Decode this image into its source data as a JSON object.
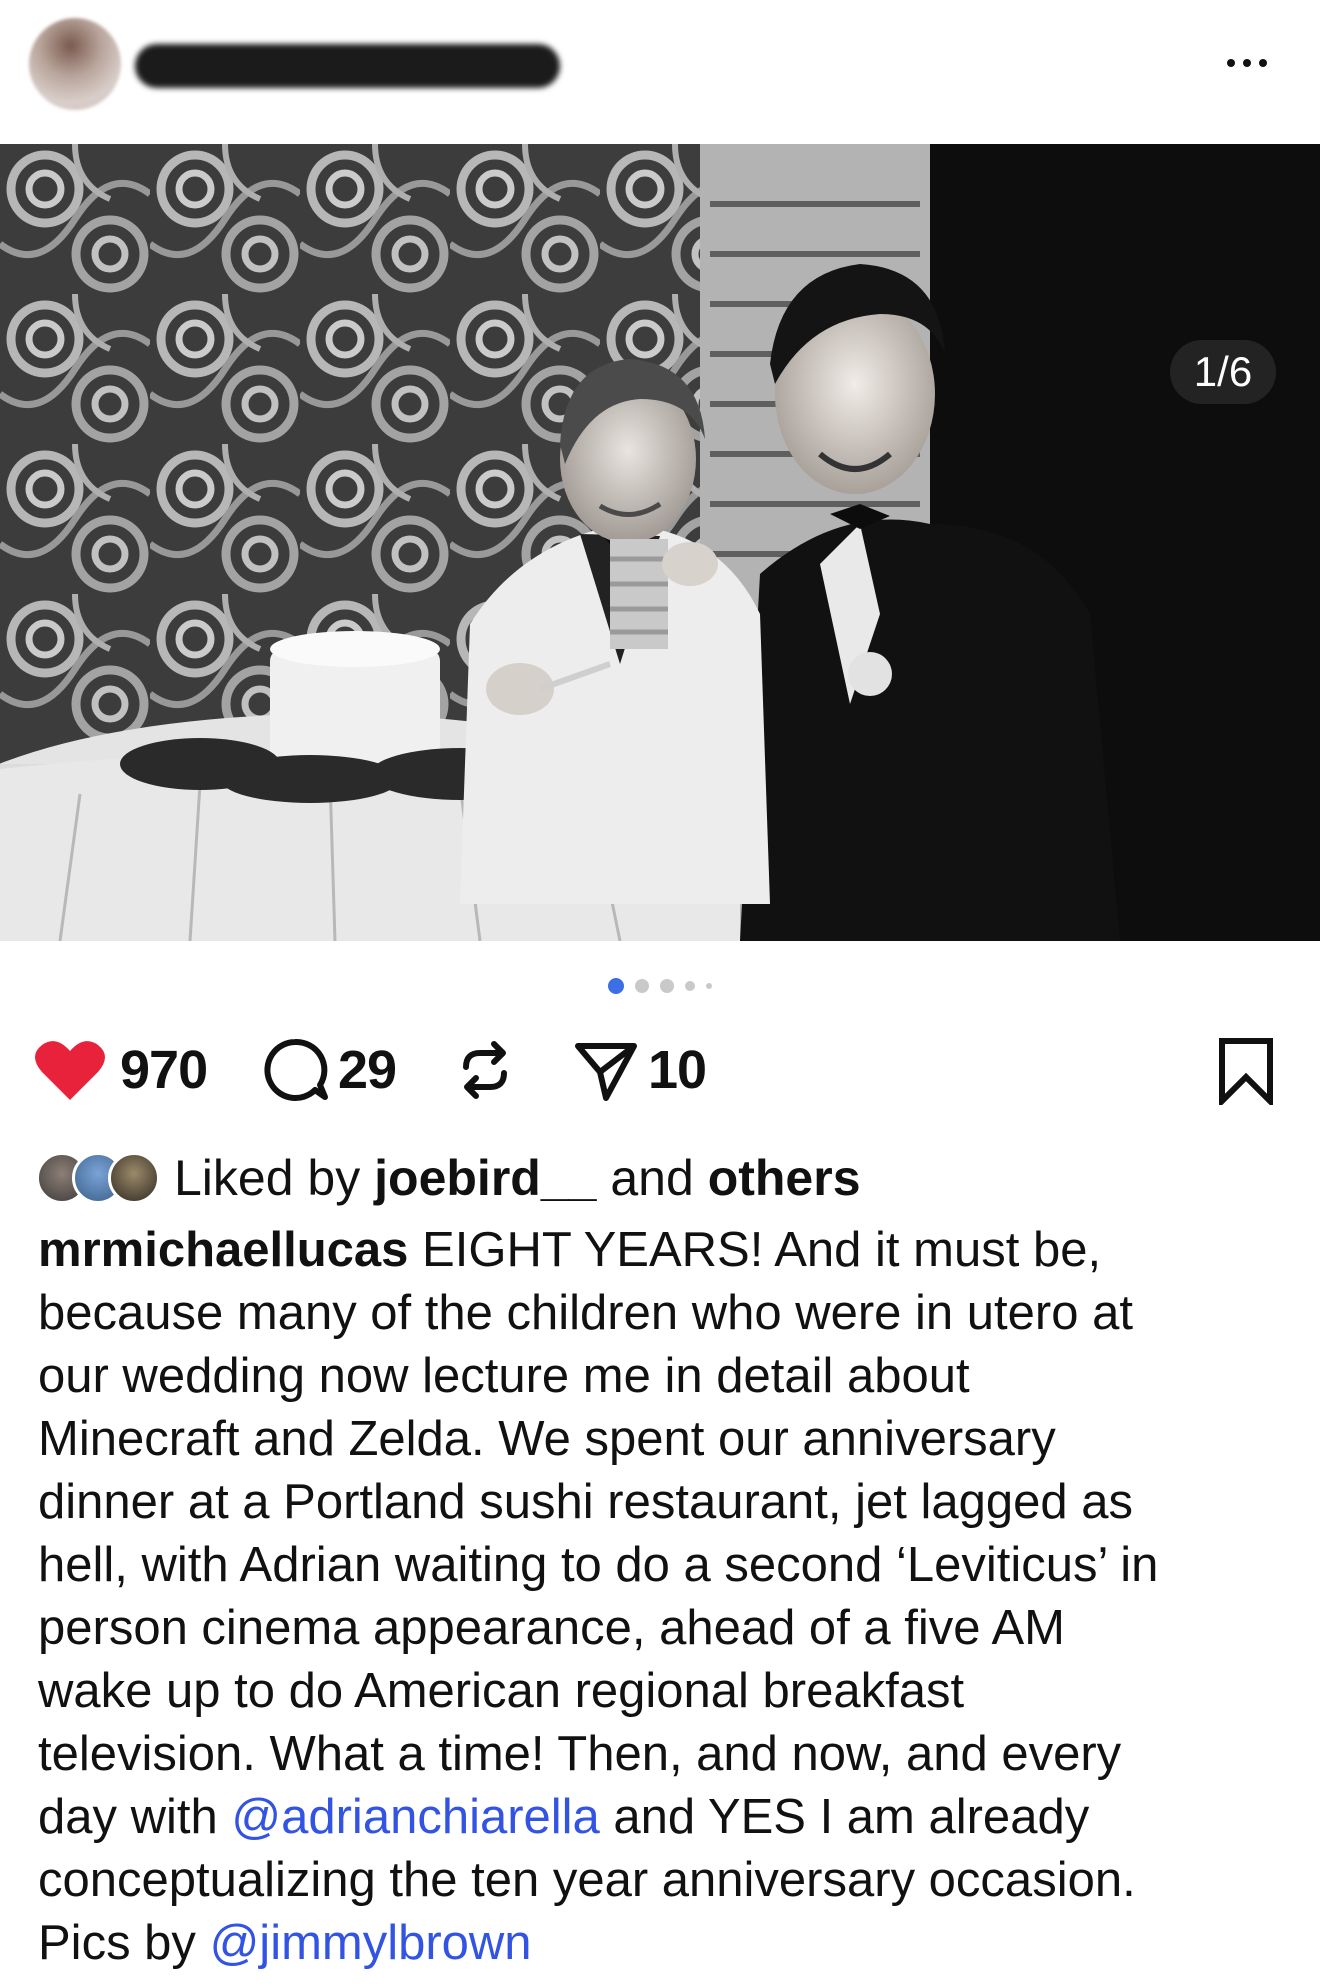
{
  "post": {
    "photo_counter": "1/6",
    "carousel_total": 5,
    "carousel_active": 0
  },
  "actions": {
    "likes": "970",
    "comments": "29",
    "shares": "10",
    "like_color": "#e8223b"
  },
  "liked_by": {
    "prefix": "Liked by",
    "user": "joebird__",
    "connector": "and",
    "others": "others"
  },
  "caption": {
    "username": "mrmichaellucas",
    "line1_rest": " EIGHT YEARS! And it must be,",
    "line2": "because many of the children who were in utero at",
    "line3": "our wedding now lecture me in detail about",
    "line4": "Minecraft and Zelda. We spent our anniversary",
    "line5": "dinner at a Portland sushi restaurant, jet lagged as",
    "line6": "hell, with Adrian waiting to do a second ‘Leviticus’ in",
    "line7": "person cinema appearance, ahead of a five AM",
    "line8": "wake up to do American regional breakfast",
    "line9": "television. What a time! Then, and now, and every",
    "line10_pre": "day with ",
    "mention1": "@adrianchiarella",
    "line10_post": " and YES I am already",
    "line11": "conceptualizing the ten year anniversary occasion.",
    "line12_pre": "Pics by ",
    "mention2": "@jimmylbrown",
    "mention_color": "#3354e3"
  }
}
